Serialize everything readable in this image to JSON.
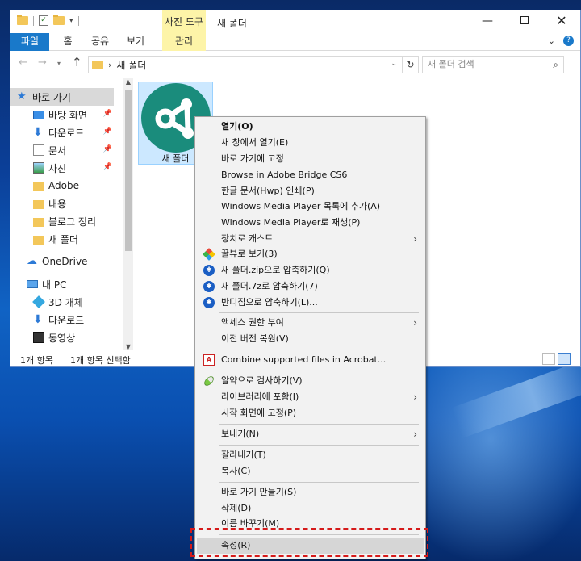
{
  "window": {
    "title": "새 폴더",
    "context_tab": "사진 도구",
    "ribbon_tabs": [
      "파일",
      "홈",
      "공유",
      "보기",
      "관리"
    ]
  },
  "address": {
    "crumb": "새 폴더",
    "search_placeholder": "새 폴더 검색"
  },
  "nav": {
    "quick_access": "바로 가기",
    "items": [
      "바탕 화면",
      "다운로드",
      "문서",
      "사진",
      "Adobe",
      "내용",
      "블로그 정리",
      "새 폴더"
    ],
    "onedrive": "OneDrive",
    "pc": "내 PC",
    "pc_items": [
      "3D 개체",
      "다운로드",
      "동영상"
    ]
  },
  "content": {
    "item_label": "새 폴더"
  },
  "status": {
    "count": "1개 항목",
    "selected": "1개 항목 선택함"
  },
  "menu": {
    "items": [
      "열기(O)",
      "새 창에서 열기(E)",
      "바로 가기에 고정",
      "Browse in Adobe Bridge CS6",
      "한글 문서(Hwp) 인쇄(P)",
      "Windows Media Player 목록에 추가(A)",
      "Windows Media Player로 재생(P)",
      "장치로 캐스트",
      "꿀뷰로 보기(3)",
      "새 폴더.zip으로 압축하기(Q)",
      "새 폴더.7z로 압축하기(7)",
      "반디집으로 압축하기(L)...",
      "액세스 권한 부여",
      "이전 버전 복원(V)",
      "Combine supported files in Acrobat...",
      "알약으로 검사하기(V)",
      "라이브러리에 포함(I)",
      "시작 화면에 고정(P)",
      "보내기(N)",
      "잘라내기(T)",
      "복사(C)",
      "바로 가기 만들기(S)",
      "삭제(D)",
      "이름 바꾸기(M)",
      "속성(R)"
    ]
  },
  "colors": {
    "accent": "#1979ca",
    "context_tab": "#fdf4a8",
    "highlight_box": "#d51a1a",
    "folder_icon_bg": "#1a8c7c"
  }
}
